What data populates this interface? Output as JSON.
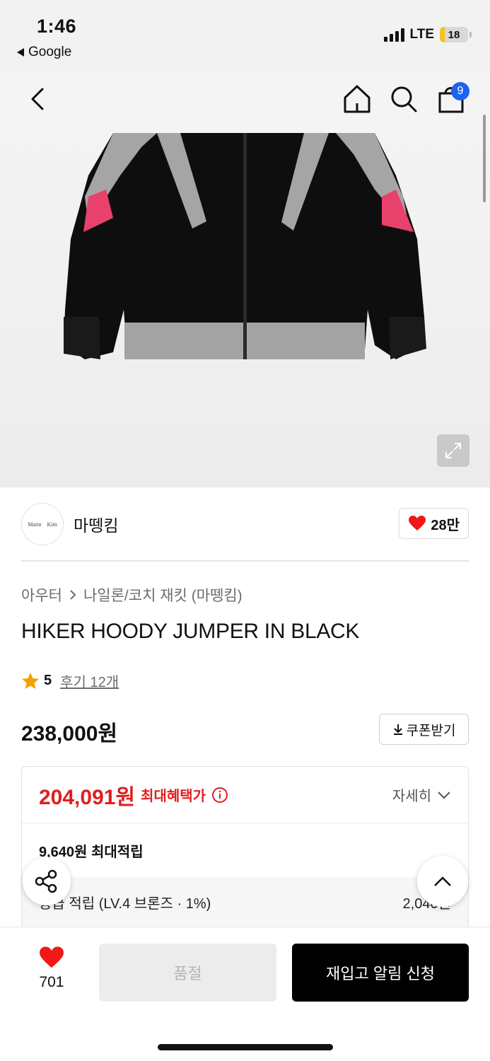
{
  "status_bar": {
    "time": "1:46",
    "back_app": "Google",
    "network": "LTE",
    "battery": "18",
    "battery_level": 0.18
  },
  "top_nav": {
    "back_icon": "chevron-left-icon",
    "home_icon": "home-icon",
    "search_icon": "search-icon",
    "bag_icon": "shopping-bag-icon",
    "bag_count": "9",
    "badge_color": "#1e63f0"
  },
  "product_image": {
    "expand_icon": "expand-icon"
  },
  "brand": {
    "logo_text": "Matin Kim",
    "name": "마뗑킴",
    "likes": "28만"
  },
  "breadcrumb": {
    "items": [
      "아우터",
      "나일론/코치 재킷 (마뗑킴)"
    ]
  },
  "product": {
    "title": "HIKER HOODY JUMPER IN BLACK",
    "rating": "5",
    "reviews": "후기 12개",
    "price": "238,000원",
    "coupon_label": "쿠폰받기"
  },
  "benefit": {
    "max_price": "204,091원",
    "max_label": "최대혜택가",
    "detail_label": "자세히",
    "points_summary": "9,640원 최대적립",
    "rows": [
      {
        "label": "등급 적립 (LV.4 브론즈 · 1%)",
        "amount": "2,040원"
      }
    ],
    "accent_color": "#e01e1e"
  },
  "bottom_bar": {
    "wish_count": "701",
    "soldout_label": "품절",
    "restock_label": "재입고 알림 신청"
  }
}
